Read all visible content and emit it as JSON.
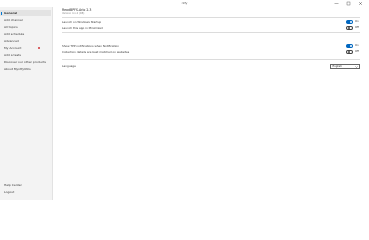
{
  "window": {
    "title": "ntfy"
  },
  "sidebar": {
    "items": [
      {
        "label": "General",
        "active": true,
        "warning": false
      },
      {
        "label": "Add channel",
        "active": false,
        "warning": false
      },
      {
        "label": "All topics",
        "active": false,
        "warning": false
      },
      {
        "label": "Add schedule",
        "active": false,
        "warning": false
      },
      {
        "label": "Advanced",
        "active": false,
        "warning": false
      },
      {
        "label": "My Account",
        "active": false,
        "warning": true
      },
      {
        "label": "Add a tests",
        "active": false,
        "warning": false
      },
      {
        "label": "Discover our other products",
        "active": false,
        "warning": false
      },
      {
        "label": "About MyntfyUtils",
        "active": false,
        "warning": false
      }
    ],
    "footer": [
      {
        "label": "Help Center"
      },
      {
        "label": "Logout"
      }
    ]
  },
  "main": {
    "app_name": "ReadBPFS-Arlo 2.3",
    "app_version": "Version 4.x.2 (R8)",
    "toggles": [
      {
        "label": "Launch on Windows Startup",
        "state_text": "On",
        "on": true
      },
      {
        "label": "Launch this app in Minimized",
        "state_text": "Off",
        "on": false
      },
      {
        "label": "Show TPP notifications when Notification",
        "state_text": "On",
        "on": true
      },
      {
        "label": "Collection details are best matched on websites",
        "state_text": "Off",
        "on": false
      }
    ],
    "language": {
      "label": "Language",
      "value": "English"
    }
  },
  "colors": {
    "accent": "#0067c0",
    "warning": "#d13438",
    "sidebar_bg": "#f3f3f3"
  }
}
